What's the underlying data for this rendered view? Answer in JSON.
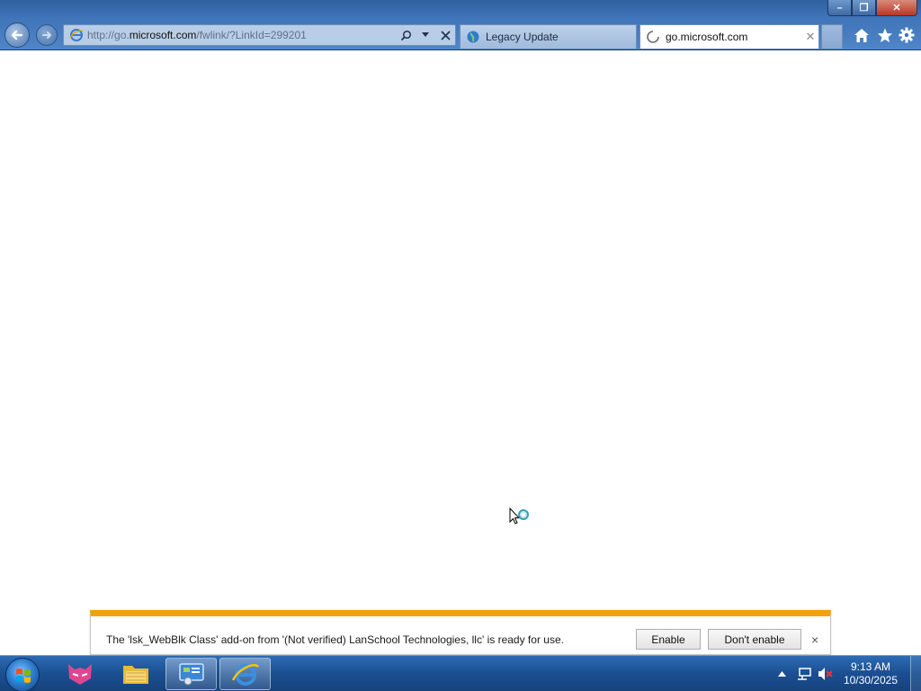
{
  "window": {
    "minimize_label": "–",
    "restore_label": "❐",
    "close_label": "✕"
  },
  "address": {
    "prefix": "http://go.",
    "host": "microsoft.com",
    "path": "/fwlink/?LinkId=299201"
  },
  "tabs": [
    {
      "label": "Legacy Update",
      "icon": "globe-icon"
    },
    {
      "label": "go.microsoft.com",
      "icon": "loading-spinner-icon",
      "close_label": "✕"
    }
  ],
  "command_icons": [
    "home-icon",
    "favorites-star-icon",
    "tools-gear-icon"
  ],
  "notification": {
    "message": "The 'lsk_WebBlk Class' add-on from '(Not verified) LanSchool Technologies, llc' is ready for use.",
    "enable_label": "Enable",
    "dont_enable_label": "Don't enable",
    "close_label": "×",
    "accent_color": "#f0a30a"
  },
  "taskbar": {
    "apps": [
      "lanschool-icon",
      "file-explorer-icon",
      "control-panel-icon",
      "internet-explorer-icon"
    ],
    "clock_time": "9:13 AM",
    "clock_date": "10/30/2025",
    "tray_icons": [
      "show-hidden-icons-arrow",
      "network-icon",
      "volume-muted-icon"
    ]
  }
}
